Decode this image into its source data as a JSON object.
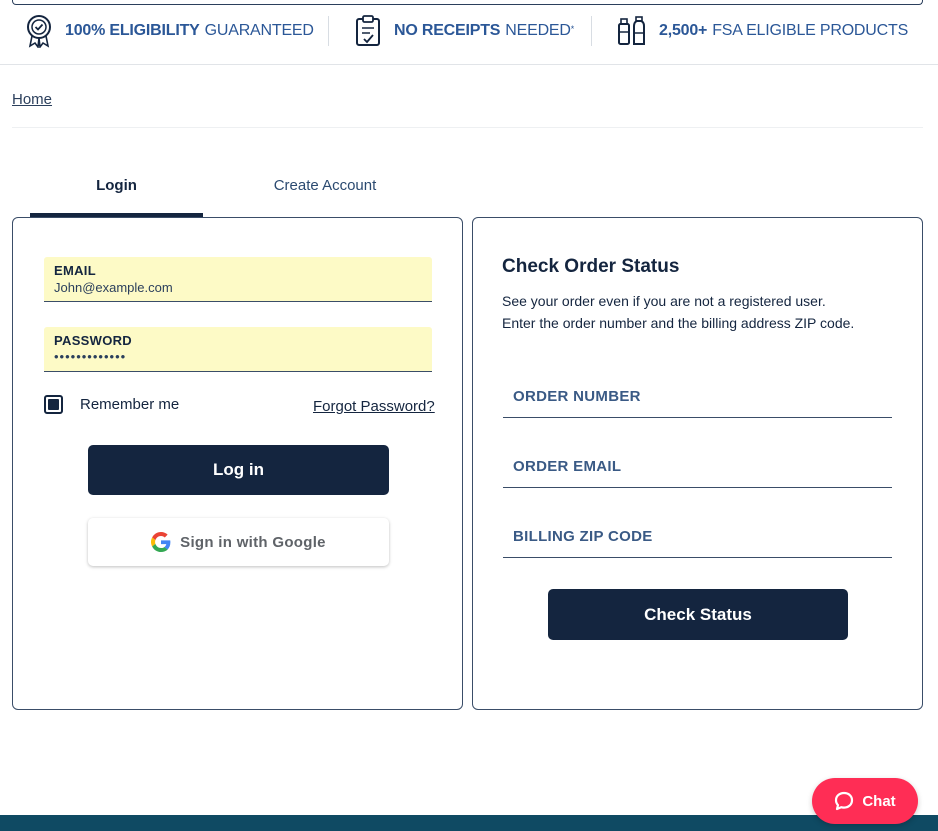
{
  "benefits": [
    {
      "icon": "badge-check-icon",
      "bold": "100% ELIGIBILITY",
      "text": "GUARANTEED",
      "sup": ""
    },
    {
      "icon": "clipboard-check-icon",
      "bold": "NO RECEIPTS",
      "text": "NEEDED",
      "sup": "*"
    },
    {
      "icon": "products-icon",
      "bold": "2,500+",
      "text": "FSA ELIGIBLE PRODUCTS",
      "sup": ""
    }
  ],
  "breadcrumb": {
    "home": "Home"
  },
  "tabs": {
    "login": "Login",
    "create": "Create Account"
  },
  "login": {
    "email_label": "EMAIL",
    "email_value": "John@example.com",
    "password_label": "PASSWORD",
    "password_value": "•••••••••••••",
    "remember_label": "Remember me",
    "remember_checked": true,
    "forgot": "Forgot Password?",
    "login_button": "Log in",
    "google_button": "Sign in with Google"
  },
  "order_status": {
    "title": "Check Order Status",
    "desc_line1": "See your order even if you are not a registered user.",
    "desc_line2": "Enter the order number and the billing address ZIP code.",
    "order_number_placeholder": "ORDER NUMBER",
    "order_email_placeholder": "ORDER EMAIL",
    "zip_placeholder": "BILLING ZIP CODE",
    "check_button": "Check Status"
  },
  "chat": {
    "label": "Chat",
    "icon": "chat-bubble-icon"
  },
  "colors": {
    "navy": "#14253f",
    "accent_blue": "#2b5797",
    "autofill": "#fdfac6",
    "chat": "#ff2d55",
    "footer": "#0f4a63"
  }
}
